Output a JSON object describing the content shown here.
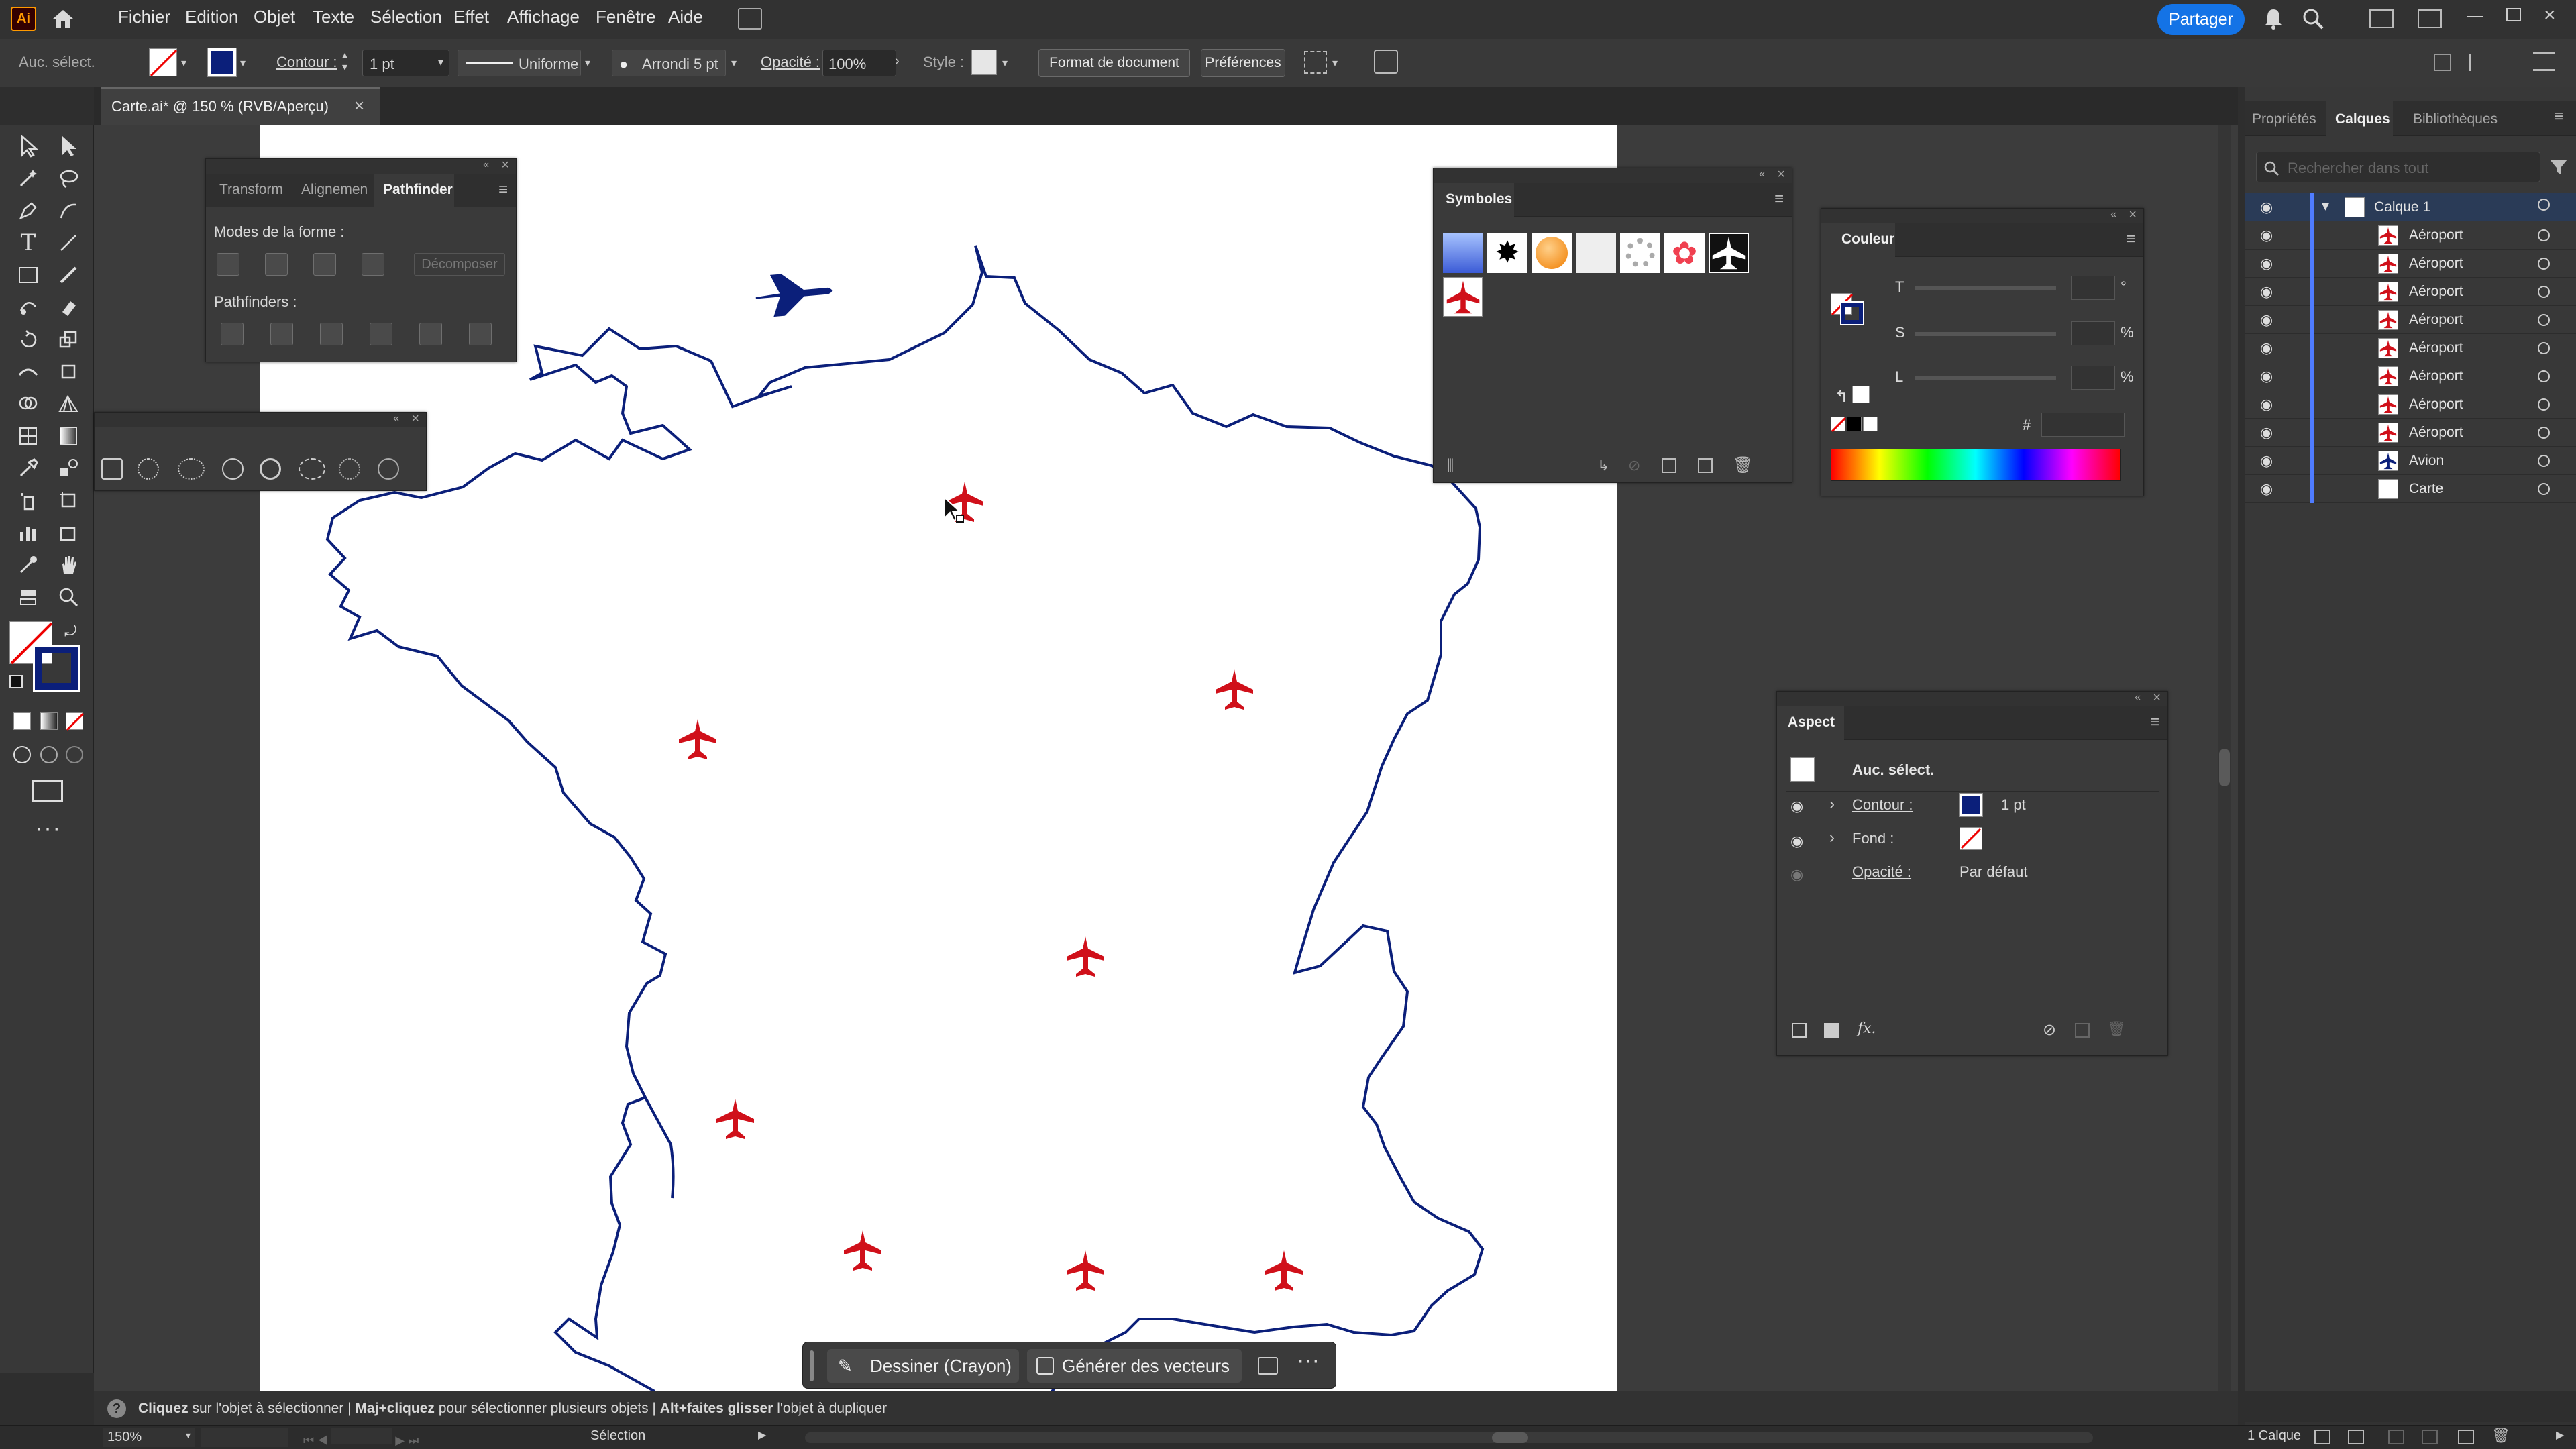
{
  "app": {
    "logo": "Ai",
    "home_icon": "home-icon"
  },
  "menu": [
    "Fichier",
    "Edition",
    "Objet",
    "Texte",
    "Sélection",
    "Effet",
    "Affichage",
    "Fenêtre",
    "Aide"
  ],
  "header": {
    "share_label": "Partager"
  },
  "control": {
    "selection_label": "Auc. sélect.",
    "stroke_label": "Contour :",
    "stroke_value": "1 pt",
    "profile_label": "Uniforme",
    "brush_label": "Arrondi 5 pt",
    "opacity_label": "Opacité :",
    "opacity_value": "100%",
    "style_label": "Style :",
    "doc_format_button": "Format de document",
    "prefs_button": "Préférences"
  },
  "document": {
    "tab_title": "Carte.ai* @ 150 % (RVB/Aperçu)"
  },
  "pathfinder_panel": {
    "tabs": [
      "Transform",
      "Alignemen",
      "Pathfinder"
    ],
    "shape_modes_label": "Modes de la forme :",
    "expand_button": "Décomposer",
    "pathfinders_label": "Pathfinders :"
  },
  "symbols_panel": {
    "title": "Symboles"
  },
  "color_panel": {
    "title": "Couleur",
    "rows": [
      {
        "label": "T",
        "unit": "°"
      },
      {
        "label": "S",
        "unit": "%"
      },
      {
        "label": "L",
        "unit": "%"
      }
    ],
    "hex_label": "#"
  },
  "appearance_panel": {
    "title": "Aspect",
    "header": "Auc. sélect.",
    "stroke_label": "Contour :",
    "stroke_value": "1 pt",
    "fill_label": "Fond :",
    "opacity_label": "Opacité :",
    "opacity_value": "Par défaut",
    "fx_label": "fx."
  },
  "right_tabs": [
    "Propriétés",
    "Calques",
    "Bibliothèques"
  ],
  "layers": {
    "search_placeholder": "Rechercher dans tout",
    "root": "Calque 1",
    "items": [
      "Aéroport",
      "Aéroport",
      "Aéroport",
      "Aéroport",
      "Aéroport",
      "Aéroport",
      "Aéroport",
      "Aéroport",
      "Avion",
      "Carte"
    ],
    "footer_count": "1 Calque"
  },
  "taskbar": {
    "draw_label": "Dessiner (Crayon)",
    "generate_label": "Générer des vecteurs"
  },
  "status": {
    "hint_bold1": "Cliquez",
    "hint_1": " sur l'objet à sélectionner  |  ",
    "hint_bold2": "Maj+cliquez",
    "hint_2": " pour sélectionner plusieurs objets  |  ",
    "hint_bold3": "Alt+faites glisser",
    "hint_3": " l'objet à dupliquer"
  },
  "bottom": {
    "zoom": "150%",
    "tool_name": "Sélection"
  },
  "colors": {
    "accent_blue": "#1473e6",
    "map_navy": "#0b1f7a",
    "airport_red": "#d0101a"
  }
}
